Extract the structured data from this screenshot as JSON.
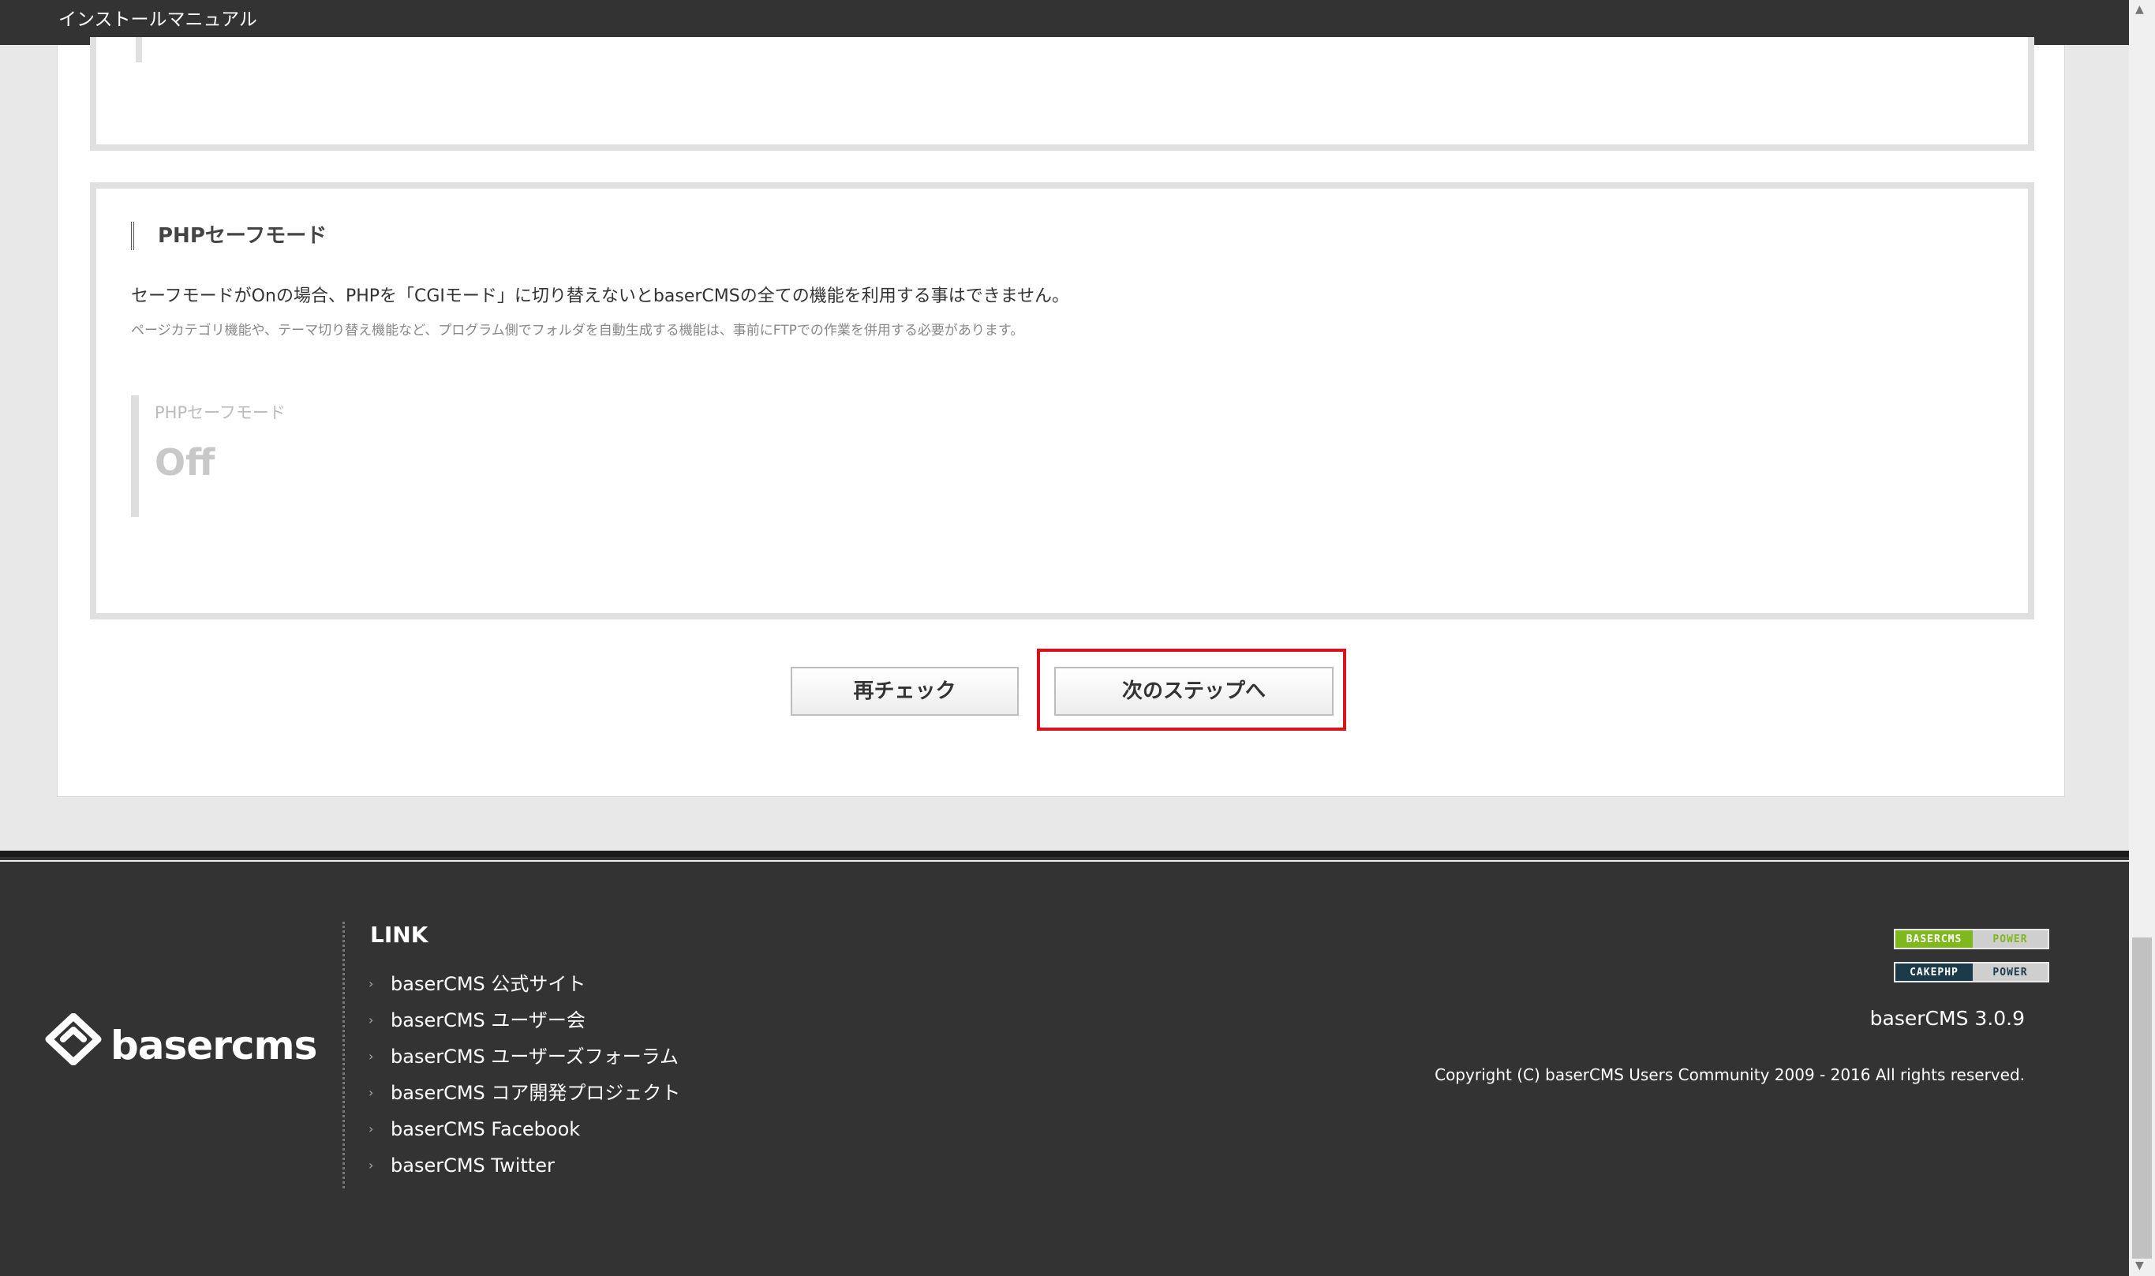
{
  "header": {
    "title": "インストールマニュアル"
  },
  "section": {
    "heading": "PHPセーフモード",
    "description": "セーフモードがOnの場合、PHPを「CGIモード」に切り替えないとbaserCMSの全ての機能を利用する事はできません。",
    "note": "ページカテゴリ機能や、テーマ切り替え機能など、プログラム側でフォルダを自動生成する機能は、事前にFTPでの作業を併用する必要があります。",
    "result_label": "PHPセーフモード",
    "result_value": "Off"
  },
  "buttons": {
    "recheck": "再チェック",
    "next": "次のステップへ"
  },
  "footer": {
    "logo_text": "basercms",
    "link_heading": "LINK",
    "links": [
      "baserCMS 公式サイト",
      "baserCMS ユーザー会",
      "baserCMS ユーザーズフォーラム",
      "baserCMS コア開発プロジェクト",
      "baserCMS Facebook",
      "baserCMS Twitter"
    ],
    "badge1": {
      "left": "BASERCMS",
      "right": "POWER"
    },
    "badge2": {
      "left": "CAKEPHP",
      "right": "POWER"
    },
    "version": "baserCMS 3.0.9",
    "copyright": "Copyright (C) baserCMS Users Community 2009 - 2016 All rights reserved."
  },
  "colors": {
    "highlight": "#d9121f",
    "footer_bg": "#333333",
    "baser_green": "#7fb81d",
    "cake_navy": "#1c3b4a"
  }
}
